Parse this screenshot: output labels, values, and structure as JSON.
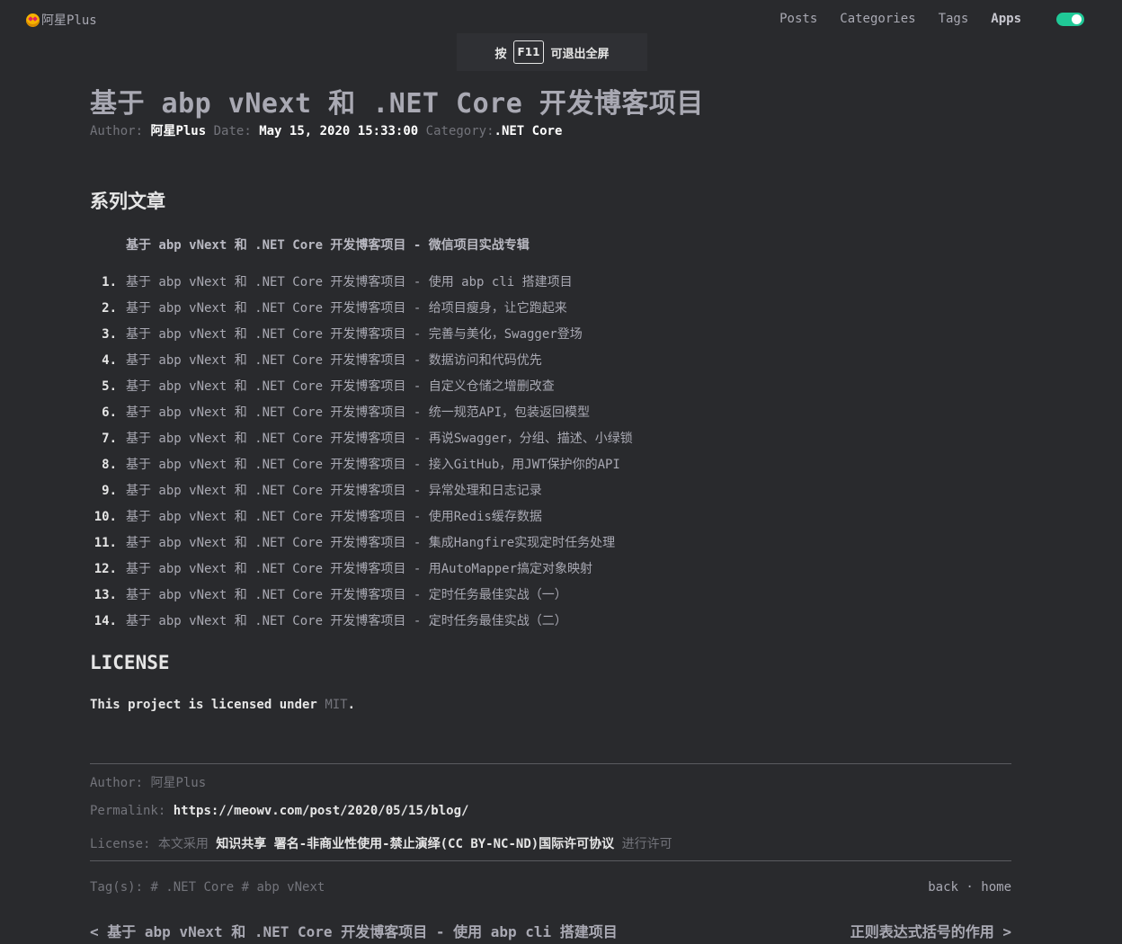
{
  "header": {
    "logo_text": "阿星Plus",
    "nav": [
      "Posts",
      "Categories",
      "Tags",
      "Apps"
    ],
    "theme_toggle_color": "#20c997"
  },
  "fullscreen_hint": {
    "prefix": "按",
    "key": "F11",
    "suffix": "可退出全屏"
  },
  "post": {
    "title": "基于 abp vNext 和 .NET Core 开发博客项目",
    "meta": {
      "author_label": "Author:",
      "author": "阿星Plus",
      "date_label": "Date:",
      "date": "May 15, 2020 15:33:00",
      "category_label": "Category:",
      "category": ".NET Core"
    },
    "series_heading": "系列文章",
    "series_quote": "基于 abp vNext 和 .NET Core 开发博客项目 - 微信项目实战专辑",
    "series": [
      {
        "num": "1.",
        "text": "基于 abp vNext 和 .NET Core 开发博客项目 - 使用 abp cli 搭建项目"
      },
      {
        "num": "2.",
        "text": "基于 abp vNext 和 .NET Core 开发博客项目 - 给项目瘦身，让它跑起来"
      },
      {
        "num": "3.",
        "text": "基于 abp vNext 和 .NET Core 开发博客项目 - 完善与美化，Swagger登场"
      },
      {
        "num": "4.",
        "text": "基于 abp vNext 和 .NET Core 开发博客项目 - 数据访问和代码优先"
      },
      {
        "num": "5.",
        "text": "基于 abp vNext 和 .NET Core 开发博客项目 - 自定义仓储之增删改查"
      },
      {
        "num": "6.",
        "text": "基于 abp vNext 和 .NET Core 开发博客项目 - 统一规范API，包装返回模型"
      },
      {
        "num": "7.",
        "text": "基于 abp vNext 和 .NET Core 开发博客项目 - 再说Swagger，分组、描述、小绿锁"
      },
      {
        "num": "8.",
        "text": "基于 abp vNext 和 .NET Core 开发博客项目 - 接入GitHub，用JWT保护你的API"
      },
      {
        "num": "9.",
        "text": "基于 abp vNext 和 .NET Core 开发博客项目 - 异常处理和日志记录"
      },
      {
        "num": "10.",
        "text": "基于 abp vNext 和 .NET Core 开发博客项目 - 使用Redis缓存数据"
      },
      {
        "num": "11.",
        "text": "基于 abp vNext 和 .NET Core 开发博客项目 - 集成Hangfire实现定时任务处理"
      },
      {
        "num": "12.",
        "text": "基于 abp vNext 和 .NET Core 开发博客项目 - 用AutoMapper搞定对象映射"
      },
      {
        "num": "13.",
        "text": "基于 abp vNext 和 .NET Core 开发博客项目 - 定时任务最佳实战（一）"
      },
      {
        "num": "14.",
        "text": "基于 abp vNext 和 .NET Core 开发博客项目 - 定时任务最佳实战（二）"
      }
    ],
    "license_heading": "LICENSE",
    "license_text": "This project is licensed under",
    "license_link": "MIT",
    "license_end": "."
  },
  "copyright": {
    "author_label": "Author:",
    "author": "阿星Plus",
    "permalink_label": "Permalink:",
    "permalink": "https://meowv.com/post/2020/05/15/blog/",
    "license_label": "License:",
    "license_pre": "本文采用",
    "license_name": "知识共享 署名-非商业性使用-禁止演绎(CC BY-NC-ND)国际许可协议",
    "license_post": "进行许可"
  },
  "footer": {
    "tags_label": "Tag(s):",
    "tags": "# .NET Core # abp vNext",
    "back": "back",
    "separator": "·",
    "home": "home",
    "prev": "< 基于 abp vNext 和 .NET Core 开发博客项目 - 使用 abp cli 搭建项目",
    "next": "正则表达式括号的作用 >"
  }
}
